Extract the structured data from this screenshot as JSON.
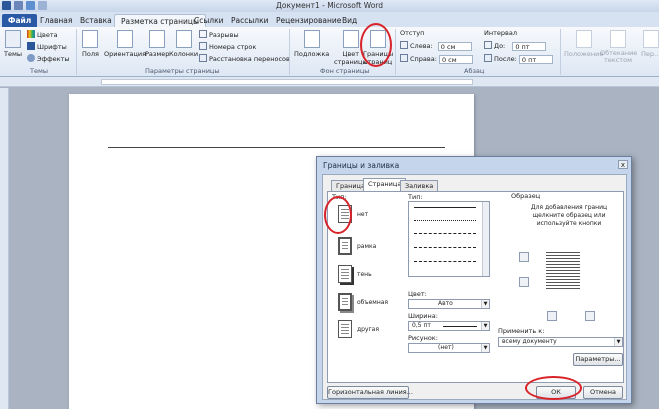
{
  "window": {
    "title": "Документ1 - Microsoft Word"
  },
  "tabs": [
    "Файл",
    "Главная",
    "Вставка",
    "Разметка страницы",
    "Ссылки",
    "Рассылки",
    "Рецензирование",
    "Вид"
  ],
  "ribbon": {
    "themes": {
      "big_label": "Темы",
      "colors": "Цвета",
      "fonts": "Шрифты",
      "effects": "Эффекты",
      "group": "Темы"
    },
    "page_setup": {
      "fields": "Поля",
      "orientation": "Ориентация",
      "size": "Размер",
      "columns": "Колонки",
      "breaks": "Разрывы",
      "line_numbers": "Номера строк",
      "hyphenation": "Расстановка переносов",
      "group": "Параметры страницы"
    },
    "background": {
      "watermark": "Подложка",
      "page_color_1": "Цвет",
      "page_color_2": "страницы",
      "page_borders_1": "Границы",
      "page_borders_2": "страниц",
      "group": "Фон страницы"
    },
    "paragraph": {
      "indent": "Отступ",
      "left": "Слева:",
      "left_value": "0 см",
      "right": "Справа:",
      "right_value": "0 см",
      "spacing": "Интервал",
      "before": "До:",
      "before_value": "0 пт",
      "after": "После:",
      "after_value": "0 пт",
      "group": "Абзац"
    },
    "arrange": {
      "position": "Положение",
      "wrap": "Обтекание текстом",
      "forward": "Пер..."
    }
  },
  "dialog": {
    "title": "Границы и заливка",
    "close": "x",
    "tabs": [
      "Граница",
      "Страница",
      "Заливка"
    ],
    "type_label": "Тип:",
    "presets": [
      "нет",
      "рамка",
      "тень",
      "объемная",
      "другая"
    ],
    "style_label": "Тип:",
    "color_label": "Цвет:",
    "color_value": "Авто",
    "width_label": "Ширина:",
    "width_value": "0,5 пт",
    "art_label": "Рисунок:",
    "art_value": "(нет)",
    "preview_label": "Образец",
    "preview_hint": "Для добавления границ щелкните образец или используйте кнопки",
    "apply_to_label": "Применить к:",
    "apply_to_value": "всему документу",
    "options_button": "Параметры...",
    "horizontal_line_button": "Горизонтальная линия...",
    "ok_button": "ОК",
    "cancel_button": "Отмена"
  }
}
